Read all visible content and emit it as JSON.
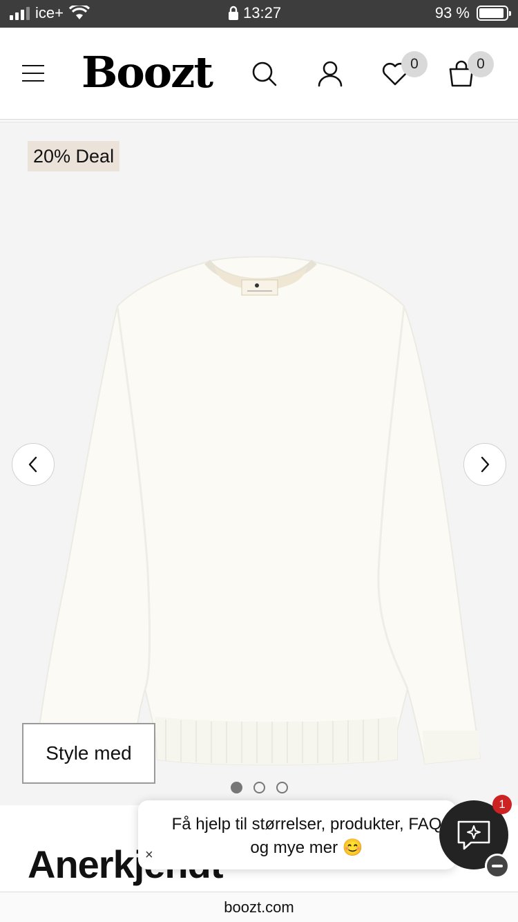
{
  "status_bar": {
    "carrier": "ice+",
    "time": "13:27",
    "battery": "93 %",
    "battery_level": 0.93
  },
  "header": {
    "logo": "Boozt",
    "wishlist_count": "0",
    "cart_count": "0"
  },
  "product": {
    "deal_tag": "20% Deal",
    "style_with": "Style med",
    "title": "Anerkjendt",
    "image_count": 3,
    "active_image": 1
  },
  "chat": {
    "message": "Få hjelp til størrelser, produkter, FAQ og mye mer 😊",
    "close": "×",
    "unread": "1"
  },
  "url_bar": {
    "url": "boozt.com"
  }
}
